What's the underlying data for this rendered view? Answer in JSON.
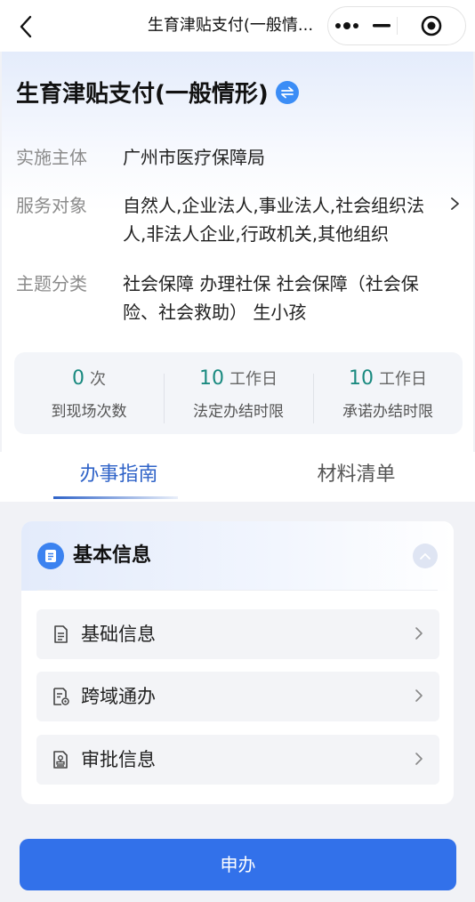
{
  "nav": {
    "title": "生育津贴支付(一般情...",
    "icons": {
      "back": "back-arrow-icon",
      "more": "more-dots-icon",
      "minimize": "minimize-icon",
      "close": "target-close-icon"
    }
  },
  "header": {
    "title": "生育津贴支付(一般情形)",
    "swap_icon": "swap-arrows-icon",
    "rows": [
      {
        "label": "实施主体",
        "value": "广州市医疗保障局"
      },
      {
        "label": "服务对象",
        "value": "自然人,企业法人,事业法人,社会组织法人,非法人企业,行政机关,其他组织"
      },
      {
        "label": "主题分类",
        "value": "社会保障 办理社保 社会保障（社会保险、社会救助） 生小孩"
      }
    ]
  },
  "stats": [
    {
      "value": "0",
      "unit": "次",
      "caption": "到现场次数"
    },
    {
      "value": "10",
      "unit": "工作日",
      "caption": "法定办结时限"
    },
    {
      "value": "10",
      "unit": "工作日",
      "caption": "承诺办结时限"
    }
  ],
  "tabs": [
    {
      "label": "办事指南",
      "active": true
    },
    {
      "label": "材料清单",
      "active": false
    }
  ],
  "card": {
    "title": "基本信息",
    "items": [
      {
        "label": "基础信息",
        "icon": "document-icon"
      },
      {
        "label": "跨域通办",
        "icon": "document-location-icon"
      },
      {
        "label": "审批信息",
        "icon": "approval-stamp-icon"
      }
    ]
  },
  "apply": {
    "label": "申办"
  },
  "colors": {
    "accent": "#3271ea",
    "stat_number": "#1a8a80",
    "tab_active": "#2f63c8"
  }
}
